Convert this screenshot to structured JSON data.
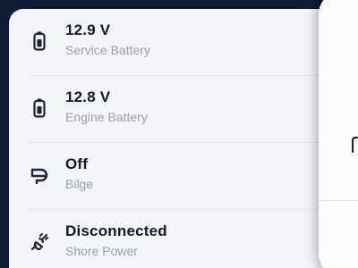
{
  "monitor": {
    "items": [
      {
        "value": "12.9 V",
        "label": "Service Battery",
        "icon": "battery-icon",
        "has_chevron": true
      },
      {
        "value": "12.8 V",
        "label": "Engine Battery",
        "icon": "battery-icon",
        "has_chevron": true
      },
      {
        "value": "Off",
        "label": "Bilge",
        "icon": "bilge-pump-icon",
        "has_chevron": false
      },
      {
        "value": "Disconnected",
        "label": "Shore Power",
        "icon": "unplugged-icon",
        "has_chevron": true
      }
    ]
  },
  "colors": {
    "background": "#0f1c33",
    "card": "#f4f5f8",
    "value_text": "#111827",
    "label_text": "#9aa0aa",
    "icon": "#1f2533"
  }
}
